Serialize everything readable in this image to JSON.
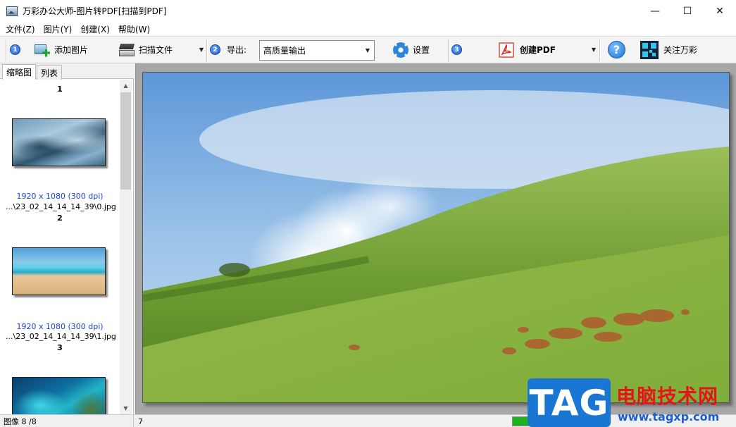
{
  "window": {
    "title": "万彩办公大师-图片转PDF[扫描到PDF]",
    "minimize": "—",
    "maximize": "☐",
    "close": "✕"
  },
  "menu": [
    "文件(Z)",
    "图片(Y)",
    "创建(X)",
    "帮助(W)"
  ],
  "toolbar": {
    "step1": "1",
    "add_images": "添加图片",
    "scan_file": "扫描文件",
    "step2": "2",
    "export_label": "导出:",
    "export_value": "高质量输出",
    "settings": "设置",
    "step3": "3",
    "create_pdf": "创建PDF",
    "help_icon": "?",
    "follow": "关注万彩"
  },
  "tabs": [
    "缩略图",
    "列表"
  ],
  "thumbnails": [
    {
      "num": "1",
      "dims": "1920 x 1080 (300 dpi)",
      "file": "...\\23_02_14_14_14_39\\0.jpg"
    },
    {
      "num": "2",
      "dims": "1920 x 1080 (300 dpi)",
      "file": "...\\23_02_14_14_14_39\\1.jpg"
    },
    {
      "num": "3",
      "dims": "",
      "file": ""
    }
  ],
  "status": {
    "images": "图像 8 /8",
    "current": "7"
  },
  "watermark": {
    "tag": "TAG",
    "title": "电脑技术网",
    "url": "www.tagxp.com"
  },
  "colors": {
    "step_blue": "#1b5cc6",
    "link_blue": "#1b3fd6",
    "progress_green": "#1fb31f",
    "watermark_red": "#e4141b",
    "watermark_blue": "#1976d2"
  }
}
